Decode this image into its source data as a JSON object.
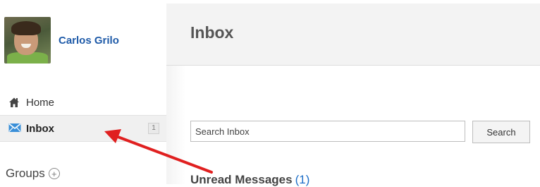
{
  "user": {
    "name": "Carlos Grilo"
  },
  "nav": {
    "items": [
      {
        "label": "Home",
        "icon": "home-icon"
      },
      {
        "label": "Inbox",
        "icon": "mail-icon",
        "badge": "1",
        "selected": true
      }
    ]
  },
  "groups": {
    "label": "Groups",
    "add_icon": "plus-circle-icon"
  },
  "header": {
    "title": "Inbox"
  },
  "search": {
    "placeholder": "Search Inbox",
    "button_label": "Search"
  },
  "section": {
    "title": "Unread Messages",
    "count": "(1)"
  },
  "colors": {
    "accent": "#1e6fc8",
    "arrow": "#e02020",
    "inbox_icon": "#3a8fd8"
  }
}
